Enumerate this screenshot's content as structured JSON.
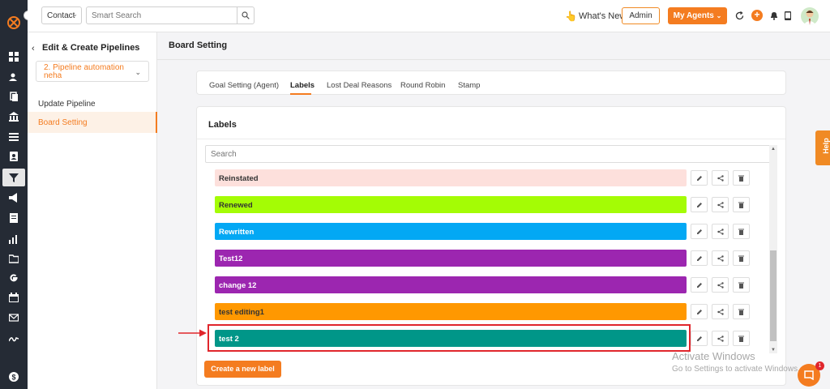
{
  "topbar": {
    "context_select": "Contact",
    "search_placeholder": "Smart Search",
    "whats_new": "What's New",
    "admin_label": "Admin",
    "agents_label": "My Agents"
  },
  "sidebar": {
    "title": "Edit & Create Pipelines",
    "pipeline_select": "2. Pipeline automation neha",
    "items": [
      {
        "label": "Update Pipeline"
      },
      {
        "label": "Board Setting"
      }
    ]
  },
  "main": {
    "page_title": "Board Setting",
    "tabs": [
      {
        "label": "Goal Setting (Agent)"
      },
      {
        "label": "Labels"
      },
      {
        "label": "Lost Deal Reasons"
      },
      {
        "label": "Round Robin"
      },
      {
        "label": "Stamp"
      }
    ],
    "labels_card": {
      "heading": "Labels",
      "search_placeholder": "Search",
      "labels": [
        {
          "name": "Reinstated",
          "color": "#fde0dc",
          "text_color": "#333333"
        },
        {
          "name": "Renewed",
          "color": "#a4fc05",
          "text_color": "#333333"
        },
        {
          "name": "Rewritten",
          "color": "#03a8f4",
          "text_color": "#ffffff"
        },
        {
          "name": "Test12",
          "color": "#9c26b0",
          "text_color": "#ffffff"
        },
        {
          "name": "change 12",
          "color": "#9c26b0",
          "text_color": "#ffffff"
        },
        {
          "name": "test editing1",
          "color": "#ff9801",
          "text_color": "#333333"
        },
        {
          "name": "test 2",
          "color": "#009688",
          "text_color": "#ffffff"
        }
      ],
      "create_button": "Create a new label"
    }
  },
  "help_tab": "Help",
  "watermark": {
    "line1": "Activate Windows",
    "line2": "Go to Settings to activate Windows."
  },
  "chat_badge": "1",
  "colors": {
    "accent": "#f47c20",
    "rail": "#252b35",
    "highlight": "#e0262c"
  }
}
